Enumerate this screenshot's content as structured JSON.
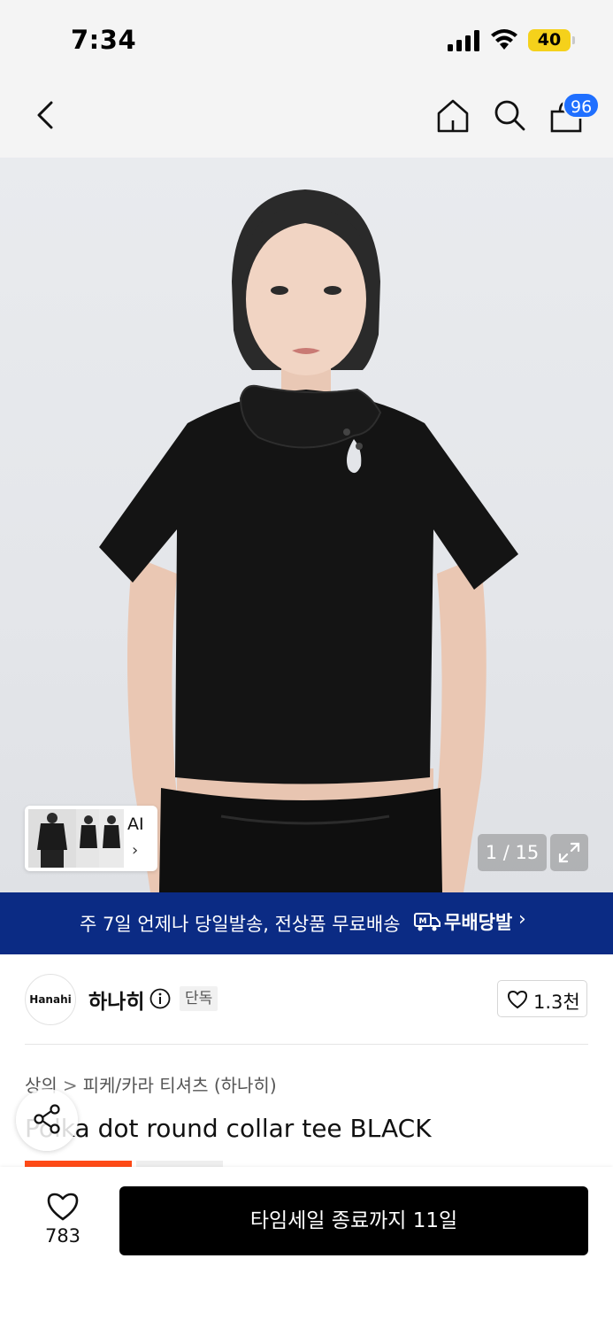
{
  "status_bar": {
    "time": "7:34",
    "battery": "40"
  },
  "nav": {
    "cart_count": "96"
  },
  "gallery": {
    "ai_label": "AI",
    "ai_chevron": "›",
    "page_counter": "1 / 15"
  },
  "shipping_banner": {
    "text": "주 7일 언제나 당일발송, 전상품 무료배송",
    "logo_text": "무배당발",
    "chevron": "›"
  },
  "brand": {
    "logo_text": "Hanahi",
    "name": "하나히",
    "badge": "단독",
    "like_count": "1.3천"
  },
  "breadcrumb": {
    "items": [
      "상의",
      "피케/카라 티셔츠 (하나히)"
    ],
    "separator": ">"
  },
  "product": {
    "title": "Polka dot round collar tee BLACK"
  },
  "bottom_bar": {
    "wish_count": "783",
    "buy_label": "타임세일 종료까지 11일"
  },
  "colors": {
    "banner_bg": "#0b2b84",
    "badge_blue": "#1f6fff",
    "sale_orange": "#ff4a17",
    "buy_button": "#000000"
  },
  "icons": [
    "back-icon",
    "home-icon",
    "search-icon",
    "shopping-bag-icon",
    "expand-icon",
    "info-icon",
    "heart-icon",
    "share-icon",
    "truck-icon"
  ]
}
